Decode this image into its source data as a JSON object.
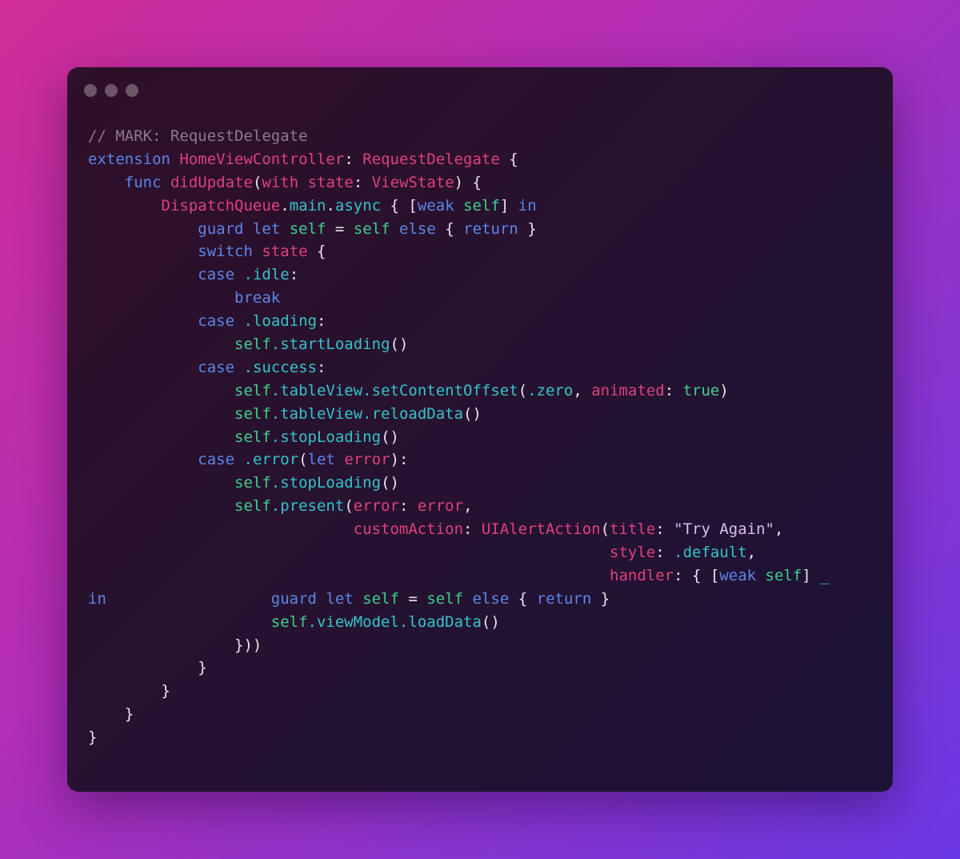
{
  "window": {
    "title_dots": [
      "close",
      "minimize",
      "maximize"
    ]
  },
  "colors": {
    "comment": "#8c7c8a",
    "keyword": "#5c86e6",
    "type_and_param": "#e1407c",
    "member": "#33c4c8",
    "self_and_literal": "#3fce8c",
    "string": "#dcbef2",
    "punctuation": "#ece4ee"
  },
  "code": {
    "language": "swift",
    "lines": [
      [
        [
          "c",
          "// MARK: RequestDelegate"
        ]
      ],
      [
        [
          "k",
          "extension"
        ],
        [
          "w",
          " "
        ],
        [
          "p",
          "HomeViewController"
        ],
        [
          "w",
          ": "
        ],
        [
          "p",
          "RequestDelegate"
        ],
        [
          "w",
          " {"
        ]
      ],
      [
        [
          "w",
          "    "
        ],
        [
          "k",
          "func"
        ],
        [
          "w",
          " "
        ],
        [
          "p",
          "didUpdate"
        ],
        [
          "w",
          "("
        ],
        [
          "p",
          "with"
        ],
        [
          "w",
          " "
        ],
        [
          "p",
          "state"
        ],
        [
          "w",
          ": "
        ],
        [
          "p",
          "ViewState"
        ],
        [
          "w",
          ") {"
        ]
      ],
      [
        [
          "w",
          "        "
        ],
        [
          "p",
          "DispatchQueue"
        ],
        [
          "w",
          "."
        ],
        [
          "t",
          "main"
        ],
        [
          "w",
          "."
        ],
        [
          "t",
          "async"
        ],
        [
          "w",
          " { ["
        ],
        [
          "k",
          "weak"
        ],
        [
          "w",
          " "
        ],
        [
          "g",
          "self"
        ],
        [
          "w",
          "] "
        ],
        [
          "k",
          "in"
        ]
      ],
      [
        [
          "w",
          "            "
        ],
        [
          "k",
          "guard"
        ],
        [
          "w",
          " "
        ],
        [
          "k",
          "let"
        ],
        [
          "w",
          " "
        ],
        [
          "g",
          "self"
        ],
        [
          "w",
          " = "
        ],
        [
          "g",
          "self"
        ],
        [
          "w",
          " "
        ],
        [
          "k",
          "else"
        ],
        [
          "w",
          " { "
        ],
        [
          "k",
          "return"
        ],
        [
          "w",
          " }"
        ]
      ],
      [
        [
          "w",
          "            "
        ],
        [
          "k",
          "switch"
        ],
        [
          "w",
          " "
        ],
        [
          "p",
          "state"
        ],
        [
          "w",
          " {"
        ]
      ],
      [
        [
          "w",
          "            "
        ],
        [
          "k",
          "case"
        ],
        [
          "w",
          " "
        ],
        [
          "t",
          ".idle"
        ],
        [
          "w",
          ":"
        ]
      ],
      [
        [
          "w",
          "                "
        ],
        [
          "k",
          "break"
        ]
      ],
      [
        [
          "w",
          "            "
        ],
        [
          "k",
          "case"
        ],
        [
          "w",
          " "
        ],
        [
          "t",
          ".loading"
        ],
        [
          "w",
          ":"
        ]
      ],
      [
        [
          "w",
          "                "
        ],
        [
          "g",
          "self"
        ],
        [
          "t",
          ".startLoading"
        ],
        [
          "w",
          "()"
        ]
      ],
      [
        [
          "w",
          "            "
        ],
        [
          "k",
          "case"
        ],
        [
          "w",
          " "
        ],
        [
          "t",
          ".success"
        ],
        [
          "w",
          ":"
        ]
      ],
      [
        [
          "w",
          "                "
        ],
        [
          "g",
          "self"
        ],
        [
          "t",
          ".tableView.setContentOffset"
        ],
        [
          "w",
          "("
        ],
        [
          "t",
          ".zero"
        ],
        [
          "w",
          ", "
        ],
        [
          "p",
          "animated"
        ],
        [
          "w",
          ": "
        ],
        [
          "g",
          "true"
        ],
        [
          "w",
          ")"
        ]
      ],
      [
        [
          "w",
          "                "
        ],
        [
          "g",
          "self"
        ],
        [
          "t",
          ".tableView.reloadData"
        ],
        [
          "w",
          "()"
        ]
      ],
      [
        [
          "w",
          "                "
        ],
        [
          "g",
          "self"
        ],
        [
          "t",
          ".stopLoading"
        ],
        [
          "w",
          "()"
        ]
      ],
      [
        [
          "w",
          "            "
        ],
        [
          "k",
          "case"
        ],
        [
          "w",
          " "
        ],
        [
          "t",
          ".error"
        ],
        [
          "w",
          "("
        ],
        [
          "k",
          "let"
        ],
        [
          "w",
          " "
        ],
        [
          "p",
          "error"
        ],
        [
          "w",
          "):"
        ]
      ],
      [
        [
          "w",
          "                "
        ],
        [
          "g",
          "self"
        ],
        [
          "t",
          ".stopLoading"
        ],
        [
          "w",
          "()"
        ]
      ],
      [
        [
          "w",
          "                "
        ],
        [
          "g",
          "self"
        ],
        [
          "t",
          ".present"
        ],
        [
          "w",
          "("
        ],
        [
          "p",
          "error"
        ],
        [
          "w",
          ": "
        ],
        [
          "p",
          "error"
        ],
        [
          "w",
          ","
        ]
      ],
      [
        [
          "w",
          "                             "
        ],
        [
          "p",
          "customAction"
        ],
        [
          "w",
          ": "
        ],
        [
          "p",
          "UIAlertAction"
        ],
        [
          "w",
          "("
        ],
        [
          "p",
          "title"
        ],
        [
          "w",
          ": "
        ],
        [
          "s",
          "\"Try Again\""
        ],
        [
          "w",
          ","
        ]
      ],
      [
        [
          "w",
          "                                                         "
        ],
        [
          "p",
          "style"
        ],
        [
          "w",
          ": "
        ],
        [
          "t",
          ".default"
        ],
        [
          "w",
          ","
        ]
      ],
      [
        [
          "w",
          "                                                         "
        ],
        [
          "p",
          "handler"
        ],
        [
          "w",
          ": { ["
        ],
        [
          "k",
          "weak"
        ],
        [
          "w",
          " "
        ],
        [
          "g",
          "self"
        ],
        [
          "w",
          "] "
        ],
        [
          "g",
          "_"
        ]
      ],
      [
        [
          "k",
          "in"
        ],
        [
          "w",
          "                  "
        ],
        [
          "k",
          "guard"
        ],
        [
          "w",
          " "
        ],
        [
          "k",
          "let"
        ],
        [
          "w",
          " "
        ],
        [
          "g",
          "self"
        ],
        [
          "w",
          " = "
        ],
        [
          "g",
          "self"
        ],
        [
          "w",
          " "
        ],
        [
          "k",
          "else"
        ],
        [
          "w",
          " { "
        ],
        [
          "k",
          "return"
        ],
        [
          "w",
          " }"
        ]
      ],
      [
        [
          "w",
          "                    "
        ],
        [
          "g",
          "self"
        ],
        [
          "t",
          ".viewModel.loadData"
        ],
        [
          "w",
          "()"
        ]
      ],
      [
        [
          "w",
          "                }))"
        ]
      ],
      [
        [
          "w",
          "            }"
        ]
      ],
      [
        [
          "w",
          "        }"
        ]
      ],
      [
        [
          "w",
          "    }"
        ]
      ],
      [
        [
          "w",
          "}"
        ]
      ]
    ]
  }
}
